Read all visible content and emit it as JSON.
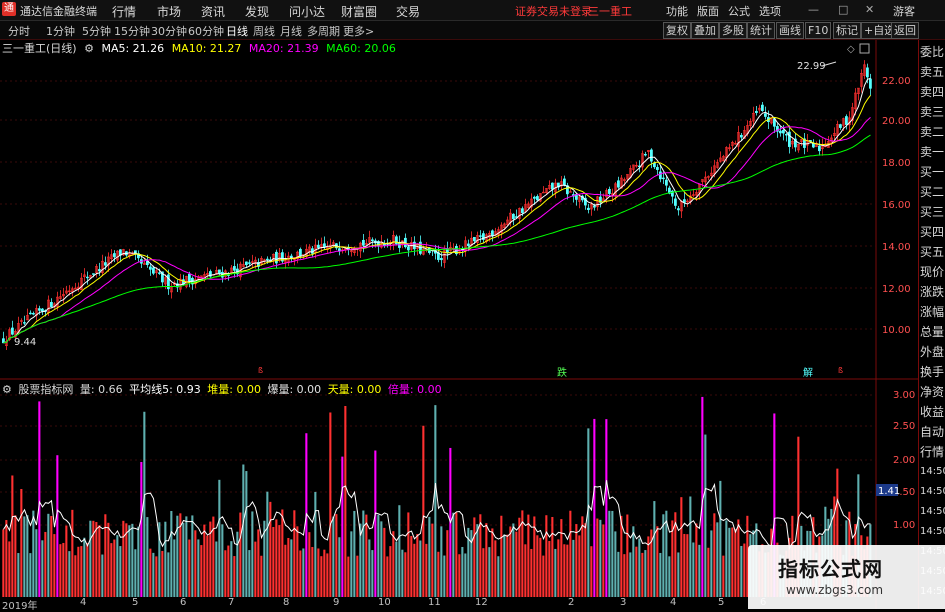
{
  "menubar": {
    "app_name": "通达信金融终端",
    "items": [
      "行情",
      "市场",
      "资讯",
      "发现",
      "问小达",
      "财富圈",
      "交易"
    ],
    "login_status": "证券交易未登录",
    "stock_name": "三一重工",
    "right_items": [
      "功能",
      "版面",
      "公式",
      "选项"
    ],
    "guest": "游客"
  },
  "tabs": {
    "items": [
      "分时",
      "1分钟",
      "5分钟",
      "15分钟",
      "30分钟",
      "60分钟",
      "日线",
      "周线",
      "月线",
      "多周期",
      "更多>"
    ],
    "active": "日线",
    "right_buttons": [
      "复权",
      "叠加",
      "多股",
      "统计",
      "画线",
      "F10",
      "标记",
      "+自选",
      "返回"
    ]
  },
  "price_info": {
    "title": "三一重工(日线)",
    "ma5": "MA5: 21.26",
    "ma10": "MA10: 21.27",
    "ma20": "MA20: 21.39",
    "ma60": "MA60: 20.06"
  },
  "volume_info": {
    "title": "股票指标网",
    "vol": "量: 0.66",
    "avg5": "平均线5: 0.93",
    "dui": "堆量: 0.00",
    "bao": "爆量: 0.00",
    "tian": "天量: 0.00",
    "bei": "倍量: 0.00"
  },
  "price_axis": [
    "22.00",
    "20.00",
    "18.00",
    "16.00",
    "14.00",
    "12.00",
    "10.00"
  ],
  "volume_axis": [
    "3.00",
    "2.50",
    "2.00",
    "1.50",
    "1.00"
  ],
  "volume_marker": "1.41",
  "high_label": "22.99",
  "low_label": "9.44",
  "signal_labels": [
    "跌",
    "解"
  ],
  "date_axis": [
    "2019年",
    "4",
    "5",
    "6",
    "7",
    "8",
    "9",
    "10",
    "11",
    "12",
    "2",
    "3",
    "4",
    "5",
    "6"
  ],
  "right_panel": [
    "委比",
    "卖五",
    "卖四",
    "卖三",
    "卖二",
    "卖一",
    "买一",
    "买二",
    "买三",
    "买四",
    "买五",
    "现价",
    "涨跌",
    "涨幅",
    "总量",
    "外盘",
    "换手",
    "净资",
    "收益",
    "自动",
    "行情",
    "14:50",
    "14:50",
    "14:50",
    "14:50",
    "14:50",
    "14:50",
    "14:50"
  ],
  "watermark": {
    "title": "指标公式网",
    "url": "www.zbgs3.com"
  },
  "colors": {
    "ma5": "#ffffff",
    "ma10": "#ffff00",
    "ma20": "#ff00ff",
    "ma60": "#00ff00",
    "up": "#ff3030",
    "down": "#54ffff",
    "alert": "#ff3a3a"
  },
  "chart_data": {
    "type": "candlestick",
    "price_range": [
      9.44,
      22.99
    ],
    "volume_range": [
      0,
      3.0
    ],
    "ma_lines": [
      "MA5",
      "MA10",
      "MA20",
      "MA60"
    ]
  }
}
